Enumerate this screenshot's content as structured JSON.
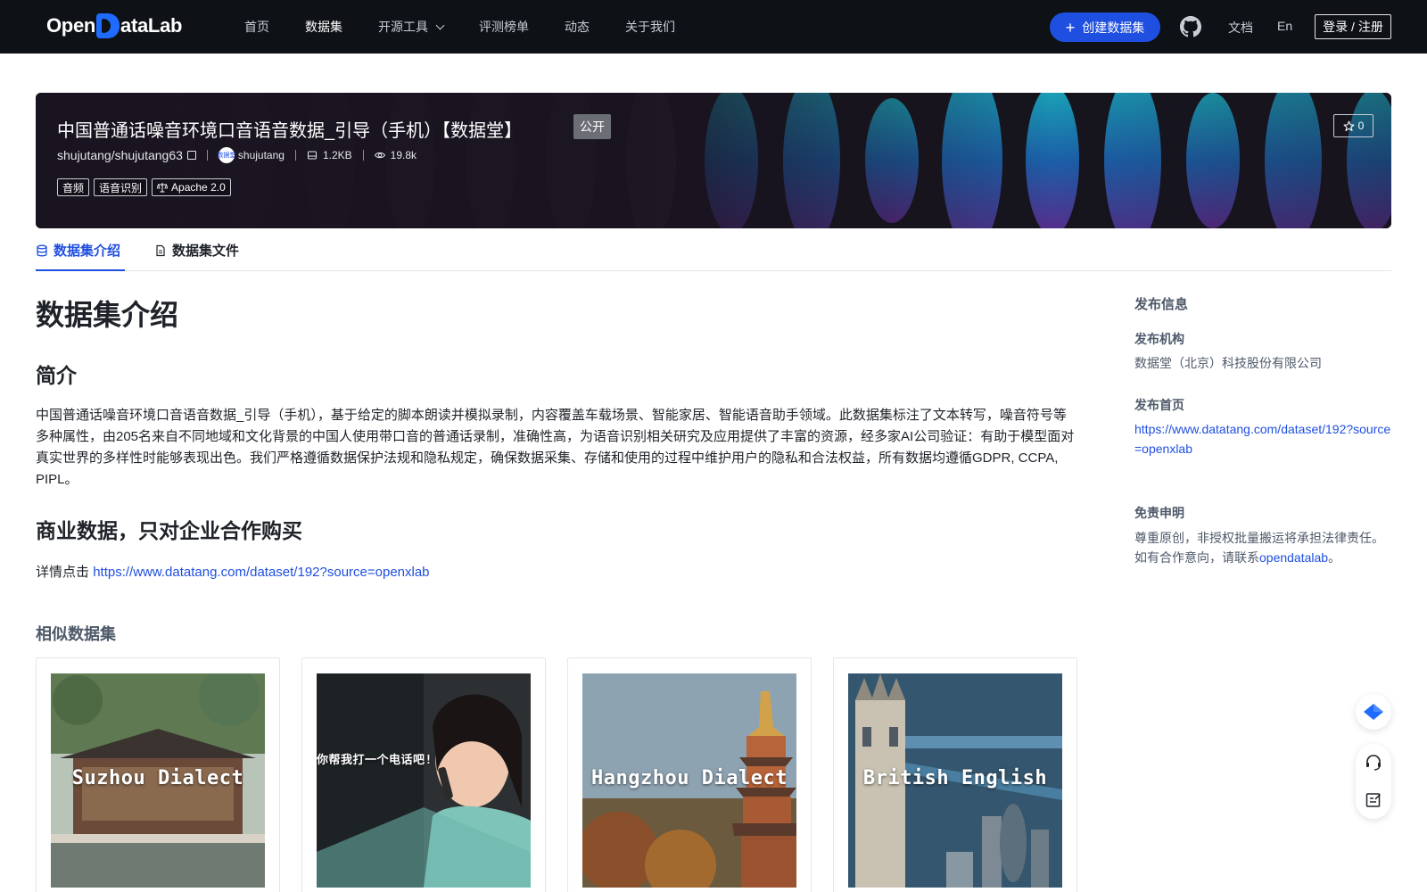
{
  "nav": {
    "logo_prefix": "Open",
    "logo_suffix": "ataLab",
    "links": [
      "首页",
      "数据集",
      "开源工具",
      "评测榜单",
      "动态",
      "关于我们"
    ],
    "create_label": "创建数据集",
    "doc_label": "文档",
    "lang_label": "En",
    "login_label": "登录 / 注册"
  },
  "banner": {
    "title": "中国普通话噪音环境口音语音数据_引导（手机）【数据堂】",
    "visibility": "公开",
    "repo": "shujutang/shujutang63",
    "owner": "shujutang",
    "owner_avatar_text": "数据堂",
    "size": "1.2KB",
    "views": "19.8k",
    "tags": [
      "音频",
      "语音识别"
    ],
    "license": "Apache 2.0",
    "stars": "0"
  },
  "tabs": {
    "intro": "数据集介绍",
    "files": "数据集文件"
  },
  "main": {
    "heading": "数据集介绍",
    "summary_heading": "简介",
    "summary": "中国普通话噪音环境口音语音数据_引导（手机），基于给定的脚本朗读并模拟录制，内容覆盖车载场景、智能家居、智能语音助手领域。此数据集标注了文本转写，噪音符号等多种属性，由205名来自不同地域和文化背景的中国人使用带口音的普通话录制，准确性高，为语音识别相关研究及应用提供了丰富的资源，经多家AI公司验证：有助于模型面对真实世界的多样性时能够表现出色。我们严格遵循数据保护法规和隐私规定，确保数据采集、存储和使用的过程中维护用户的隐私和合法权益，所有数据均遵循GDPR, CCPA, PIPL。",
    "commercial_heading": "商业数据，只对企业合作购买",
    "detail_prefix": "详情点击",
    "detail_link": "https://www.datatang.com/dataset/192?source=openxlab",
    "similar_heading": "相似数据集",
    "cards": [
      {
        "label": "Suzhou Dialect"
      },
      {
        "label": "你帮我打一个电话吧!"
      },
      {
        "label": "Hangzhou Dialect"
      },
      {
        "label": "British English"
      }
    ]
  },
  "sidebar": {
    "title": "发布信息",
    "org_label": "发布机构",
    "org_value": "数据堂（北京）科技股份有限公司",
    "home_label": "发布首页",
    "home_value": "https://www.datatang.com/dataset/192?source=openxlab",
    "disclaimer_label": "免责申明",
    "disclaimer_line1": "尊重原创，非授权批量搬运将承担法律责任。",
    "disclaimer_line2_prefix": "如有合作意向，请联系",
    "disclaimer_link": "opendatalab",
    "disclaimer_line2_suffix": "。"
  },
  "colors": {
    "accent": "#1f4fe0",
    "nav_bg": "#0e1116"
  }
}
